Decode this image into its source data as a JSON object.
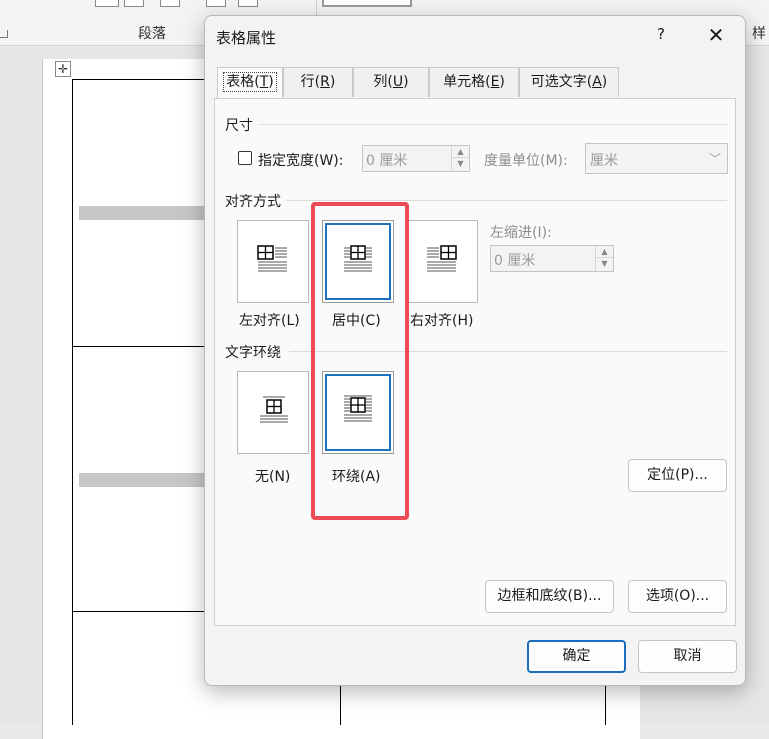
{
  "ribbon": {
    "group_label": "段落",
    "group_label_2": "样"
  },
  "dialog": {
    "title": "表格属性",
    "help_glyph": "?",
    "close_glyph": "✕",
    "tabs": [
      {
        "text": "表格(",
        "key": "T",
        "tail": ")"
      },
      {
        "text": "行(",
        "key": "R",
        "tail": ")"
      },
      {
        "text": "列(",
        "key": "U",
        "tail": ")"
      },
      {
        "text": "单元格(",
        "key": "E",
        "tail": ")"
      },
      {
        "text": "可选文字(",
        "key": "A",
        "tail": ")"
      }
    ],
    "size": {
      "section_label": "尺寸",
      "preferred_width_label": "指定宽度(W):",
      "preferred_width_checked": false,
      "width_value": "0 厘米",
      "measure_label": "度量单位(M):",
      "measure_value": "厘米"
    },
    "alignment": {
      "section_label": "对齐方式",
      "options": [
        {
          "label": "左对齐(L)",
          "selected": false
        },
        {
          "label": "居中(C)",
          "selected": true
        },
        {
          "label": "右对齐(H)",
          "selected": false
        }
      ],
      "indent_label": "左缩进(I):",
      "indent_value": "0 厘米"
    },
    "wrapping": {
      "section_label": "文字环绕",
      "options": [
        {
          "label": "无(N)",
          "selected": false
        },
        {
          "label": "环绕(A)",
          "selected": true
        }
      ],
      "positioning_button": "定位(P)..."
    },
    "buttons": {
      "borders_shading": "边框和底纹(B)...",
      "options": "选项(O)...",
      "ok": "确定",
      "cancel": "取消"
    }
  },
  "colors": {
    "selection_blue": "#1e73be",
    "highlight_red": "#ec4a55",
    "primary_button_border": "#1e6cc0"
  }
}
